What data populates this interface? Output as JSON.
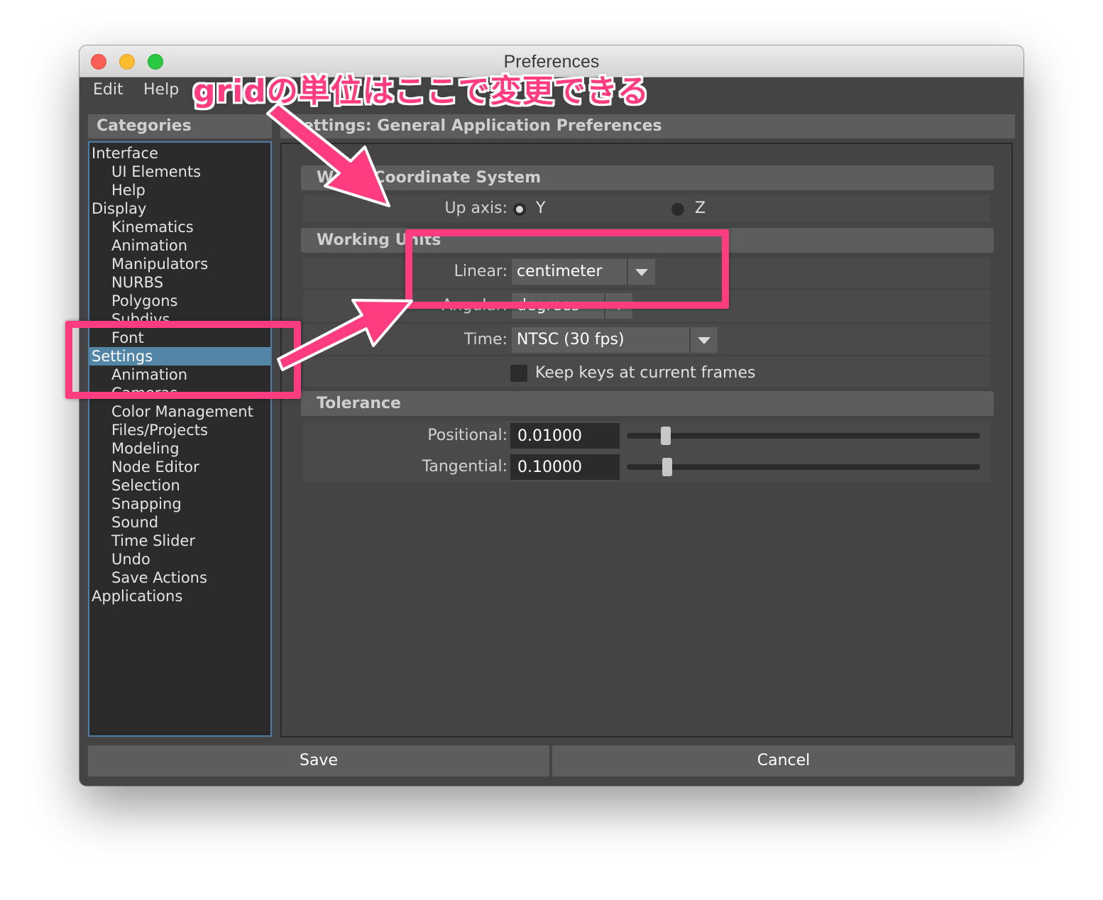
{
  "window": {
    "title": "Preferences",
    "menu": [
      "Edit",
      "Help"
    ]
  },
  "categories": {
    "header": "Categories",
    "items": [
      {
        "label": "Interface",
        "level": 0,
        "selected": false
      },
      {
        "label": "UI Elements",
        "level": 1,
        "selected": false
      },
      {
        "label": "Help",
        "level": 1,
        "selected": false
      },
      {
        "label": "Display",
        "level": 0,
        "selected": false
      },
      {
        "label": "Kinematics",
        "level": 1,
        "selected": false
      },
      {
        "label": "Animation",
        "level": 1,
        "selected": false
      },
      {
        "label": "Manipulators",
        "level": 1,
        "selected": false
      },
      {
        "label": "NURBS",
        "level": 1,
        "selected": false
      },
      {
        "label": "Polygons",
        "level": 1,
        "selected": false
      },
      {
        "label": "Subdivs",
        "level": 1,
        "selected": false
      },
      {
        "label": "Font",
        "level": 1,
        "selected": false
      },
      {
        "label": "Settings",
        "level": 0,
        "selected": true
      },
      {
        "label": "Animation",
        "level": 1,
        "selected": false
      },
      {
        "label": "Cameras",
        "level": 1,
        "selected": false
      },
      {
        "label": "Color Management",
        "level": 1,
        "selected": false
      },
      {
        "label": "Files/Projects",
        "level": 1,
        "selected": false
      },
      {
        "label": "Modeling",
        "level": 1,
        "selected": false
      },
      {
        "label": "Node Editor",
        "level": 1,
        "selected": false
      },
      {
        "label": "Selection",
        "level": 1,
        "selected": false
      },
      {
        "label": "Snapping",
        "level": 1,
        "selected": false
      },
      {
        "label": "Sound",
        "level": 1,
        "selected": false
      },
      {
        "label": "Time Slider",
        "level": 1,
        "selected": false
      },
      {
        "label": "Undo",
        "level": 1,
        "selected": false
      },
      {
        "label": "Save Actions",
        "level": 1,
        "selected": false
      },
      {
        "label": "Applications",
        "level": 0,
        "selected": false
      }
    ]
  },
  "settings": {
    "header": "Settings: General Application Preferences",
    "world": {
      "title": "World Coordinate System",
      "up_axis_label": "Up axis:",
      "options": [
        {
          "label": "Y",
          "checked": true
        },
        {
          "label": "Z",
          "checked": false
        }
      ]
    },
    "units": {
      "title": "Working Units",
      "linear_label": "Linear:",
      "linear_value": "centimeter",
      "angular_label": "Angular:",
      "angular_value": "degrees",
      "time_label": "Time:",
      "time_value": "NTSC (30 fps)",
      "keep_keys_label": "Keep keys at current frames",
      "keep_keys_checked": false
    },
    "tolerance": {
      "title": "Tolerance",
      "positional_label": "Positional:",
      "positional_value": "0.01000",
      "positional_slider_fraction": 0.11,
      "tangential_label": "Tangential:",
      "tangential_value": "0.10000",
      "tangential_slider_fraction": 0.115
    }
  },
  "buttons": {
    "save": "Save",
    "cancel": "Cancel"
  },
  "annotation": {
    "text": "gridの単位はここで変更できる",
    "color": "#ff3c7f"
  },
  "colors": {
    "selection": "#5285a6",
    "panel": "#444444",
    "header": "#5d5d5d",
    "field": "#2b2b2b"
  }
}
